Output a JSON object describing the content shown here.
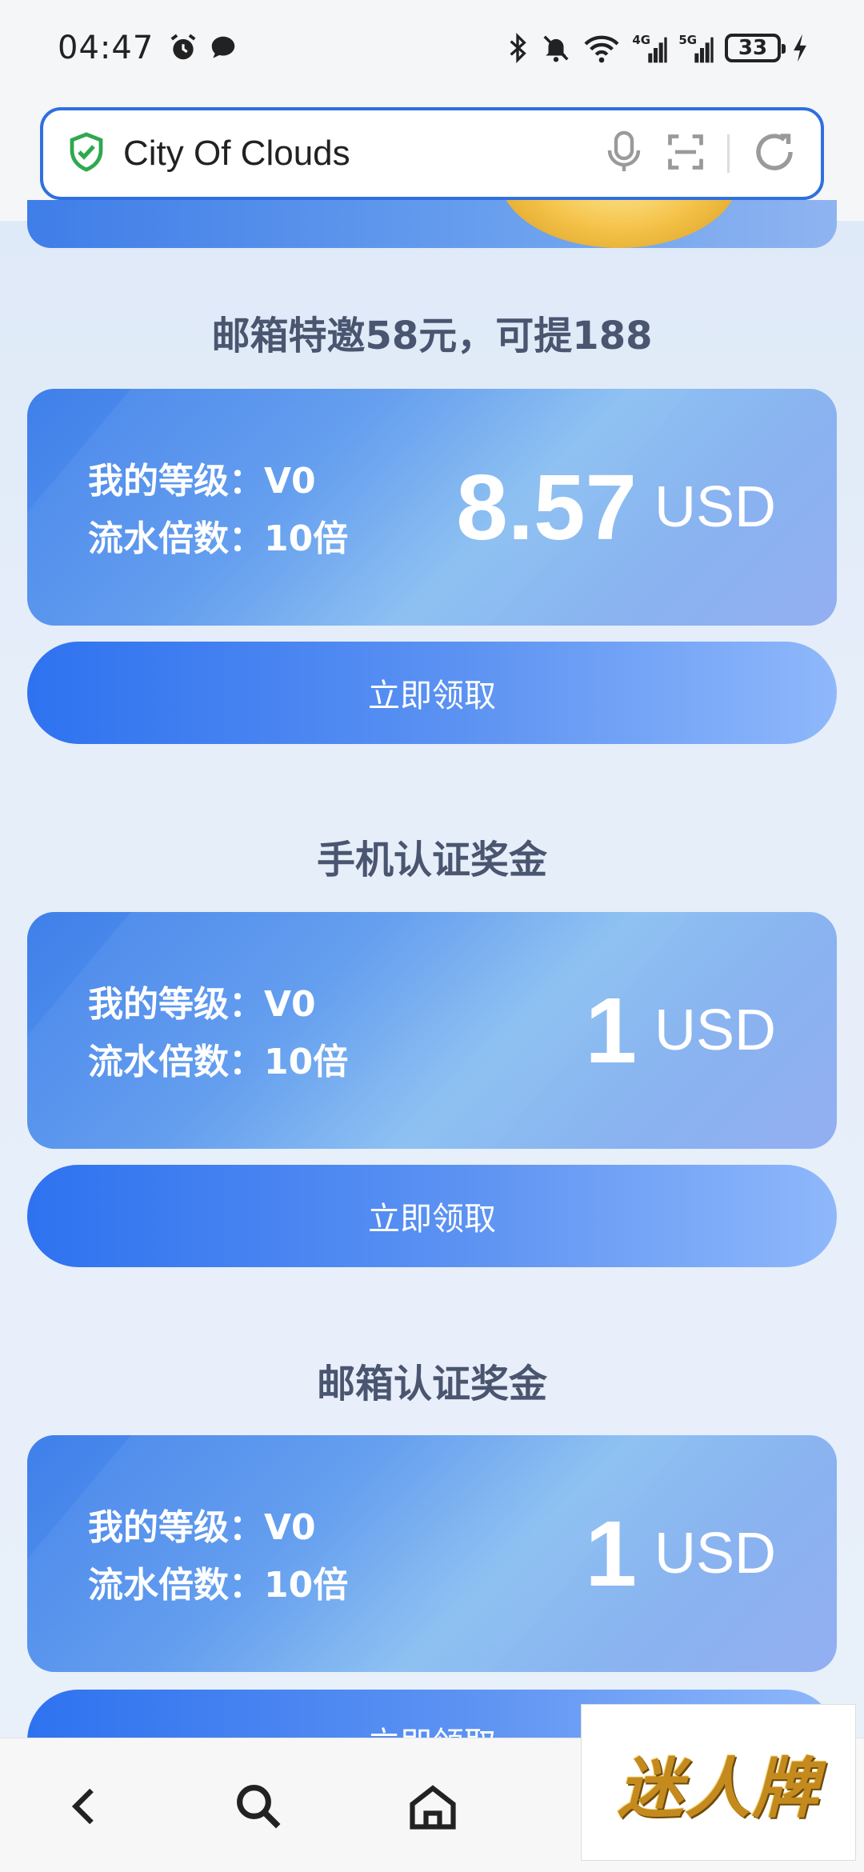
{
  "status_bar": {
    "time": "04:47",
    "battery": "33"
  },
  "browser": {
    "title": "City Of Clouds"
  },
  "sections": [
    {
      "title": "邮箱特邀58元，可提188",
      "level_label": "我的等级：V0",
      "multiplier_label": "流水倍数：10倍",
      "amount": "8.57",
      "currency": "USD",
      "button": "立即领取"
    },
    {
      "title": "手机认证奖金",
      "level_label": "我的等级：V0",
      "multiplier_label": "流水倍数：10倍",
      "amount": "1",
      "currency": "USD",
      "button": "立即领取"
    },
    {
      "title": "邮箱认证奖金",
      "level_label": "我的等级：V0",
      "multiplier_label": "流水倍数：10倍",
      "amount": "1",
      "currency": "USD",
      "button": "立即领取"
    }
  ],
  "watermark": {
    "text": "迷人牌"
  },
  "colors": {
    "accent": "#2f6fe0",
    "card_start": "#3e7fea",
    "card_end": "#93aff1",
    "title_text": "#4a5570"
  }
}
